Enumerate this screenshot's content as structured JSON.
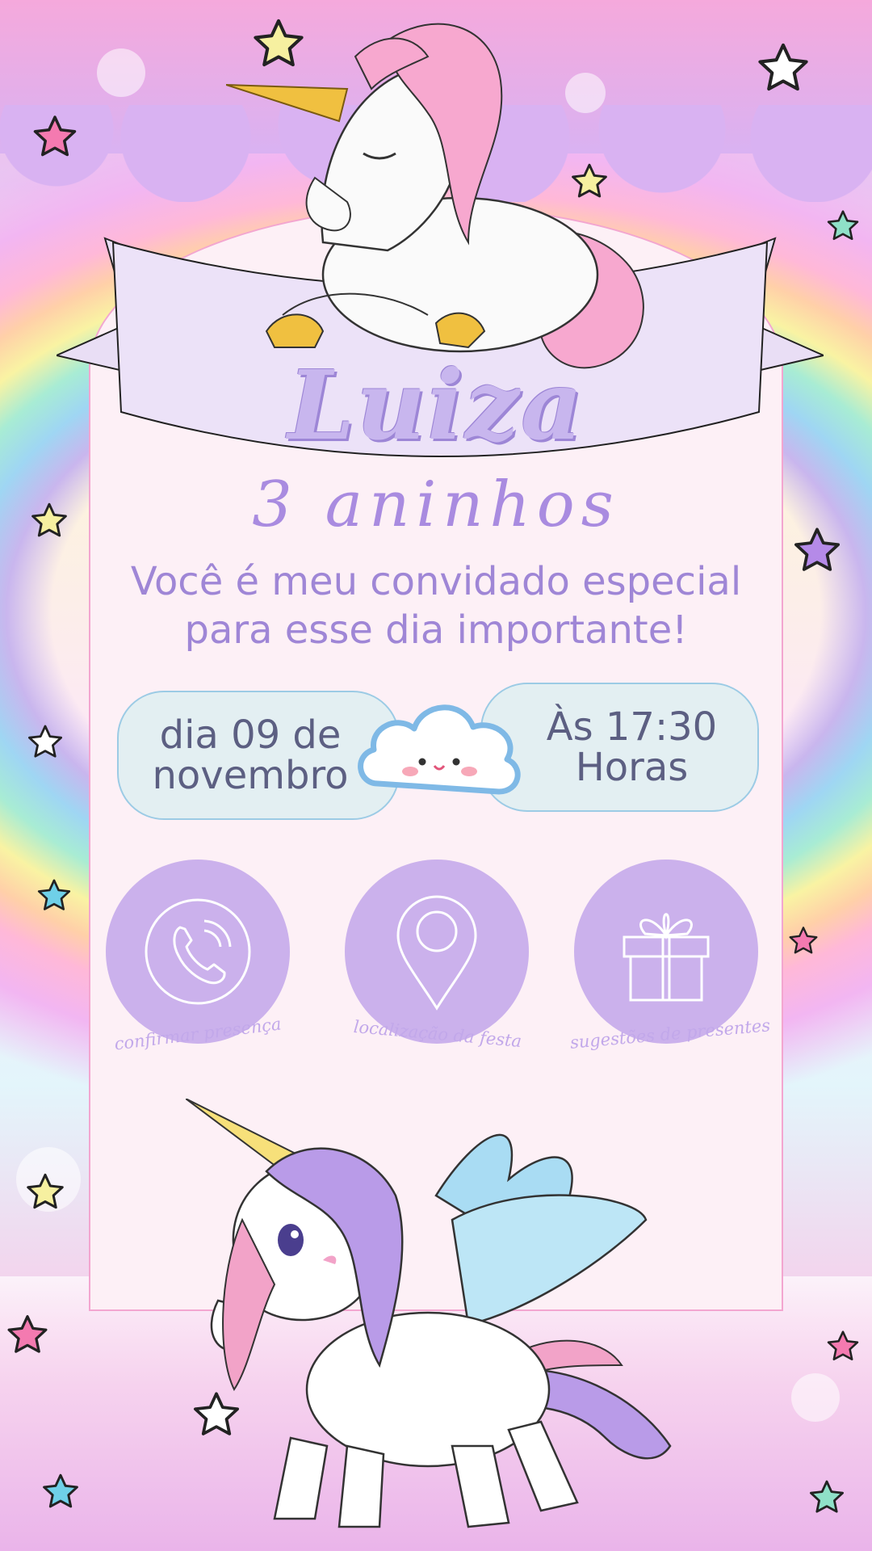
{
  "invite": {
    "name": "Luiza",
    "age": "3 aninhos",
    "message_line1": "Você é meu convidado especial",
    "message_line2": "para esse dia importante!",
    "date_line1": "dia 09 de",
    "date_line2": "novembro",
    "time_line1": "Às 17:30",
    "time_line2": "Horas"
  },
  "actions": [
    {
      "label": "confirmar presença",
      "icon": "phone-icon"
    },
    {
      "label": "localização da festa",
      "icon": "location-pin-icon"
    },
    {
      "label": "sugestões de presentes",
      "icon": "gift-icon"
    }
  ],
  "colors": {
    "card": "#fdf0f6",
    "accent_purple": "#cbb1ec",
    "name_text": "#c8b6ee",
    "pill_bg": "#e3eff2",
    "pill_border": "#9ccbe5"
  }
}
